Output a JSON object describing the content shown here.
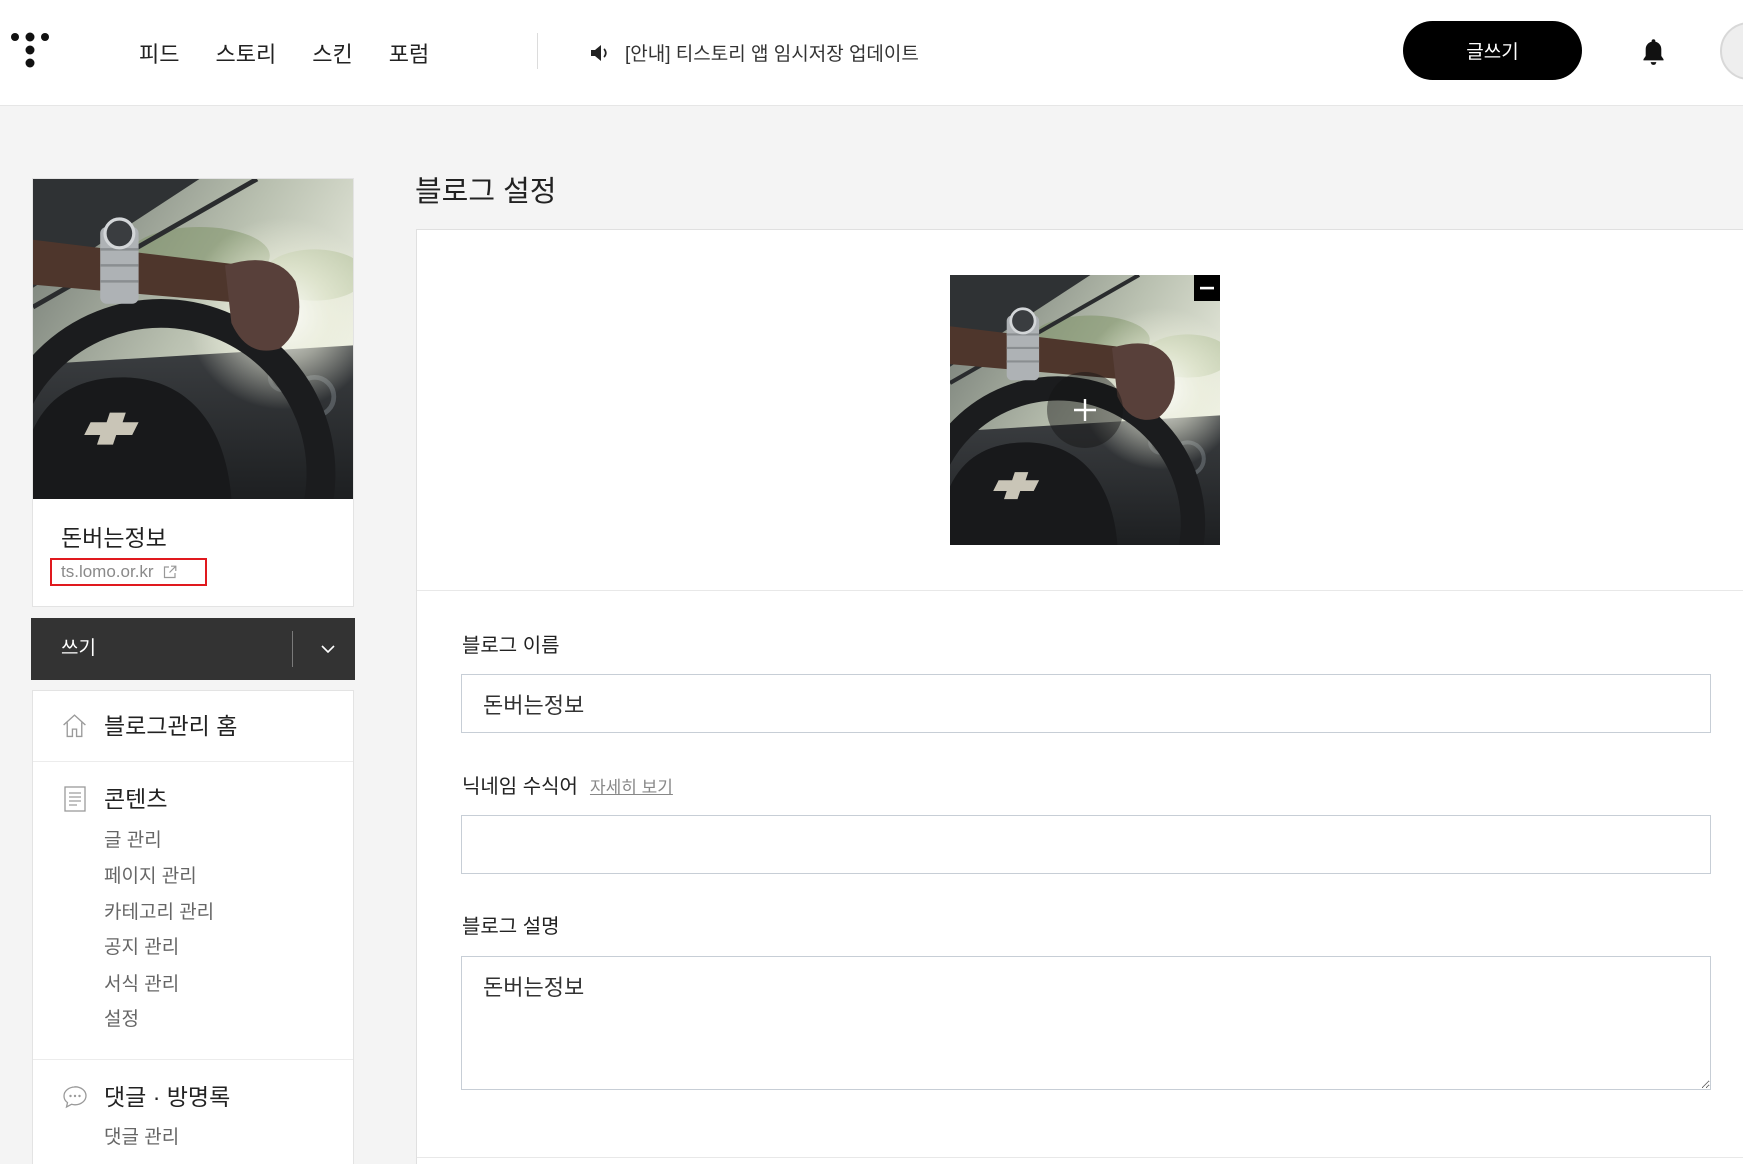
{
  "header": {
    "logo_icon": "tistory-logo-icon",
    "nav": [
      {
        "label": "피드"
      },
      {
        "label": "스토리"
      },
      {
        "label": "스킨"
      },
      {
        "label": "포럼"
      }
    ],
    "notice_icon": "speaker-icon",
    "notice": "[안내] 티스토리 앱 임시저장 업데이트",
    "write_button": "글쓰기",
    "bell_icon": "bell-icon",
    "avatar_icon": "user-avatar"
  },
  "sidebar": {
    "blog_name": "돈버는정보",
    "blog_url": "ts.lomo.or.kr",
    "url_icon": "external-link-icon",
    "write_label": "쓰기",
    "write_toggle_icon": "chevron-down-icon",
    "home": {
      "label": "블로그관리 홈",
      "icon": "home-icon"
    },
    "sections": [
      {
        "title": "콘텐츠",
        "icon": "document-icon",
        "items": [
          "글 관리",
          "페이지 관리",
          "카테고리 관리",
          "공지 관리",
          "서식 관리",
          "설정"
        ]
      },
      {
        "title": "댓글 · 방명록",
        "icon": "comment-icon",
        "items": [
          "댓글 관리"
        ]
      }
    ]
  },
  "main": {
    "title": "블로그 설정",
    "image_controls": {
      "remove_icon": "minus-icon",
      "add_icon": "plus-icon"
    },
    "fields": {
      "blog_name": {
        "label": "블로그 이름",
        "value": "돈버는정보"
      },
      "nickname": {
        "label": "닉네임 수식어",
        "help_link": "자세히 보기",
        "value": ""
      },
      "description": {
        "label": "블로그 설명",
        "value": "돈버는정보"
      }
    }
  },
  "colors": {
    "page_background": "#f4f4f4",
    "write_button": "#000000",
    "write_bar": "#333333",
    "highlight_box": "#e0191e",
    "menu_sub_text": "#666666",
    "input_border": "#c7ced6"
  }
}
